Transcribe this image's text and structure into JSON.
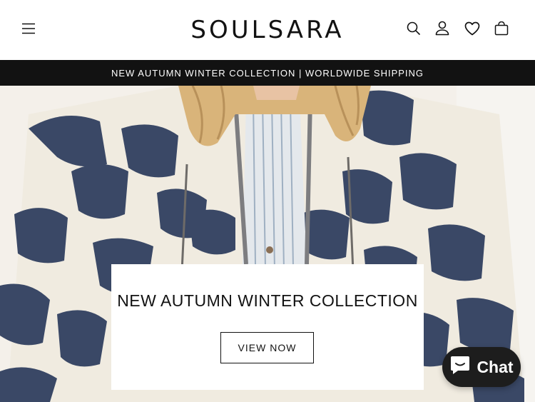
{
  "header": {
    "logo_text": "SOULSARA",
    "icons": {
      "menu": "hamburger-menu-icon",
      "search": "search-icon",
      "account": "user-icon",
      "wishlist": "heart-icon",
      "cart": "shopping-bag-icon"
    }
  },
  "announcement": {
    "text": "NEW AUTUMN WINTER COLLECTION | WORLDWIDE SHIPPING"
  },
  "hero": {
    "title": "NEW AUTUMN WINTER COLLECTION",
    "button_label": "VIEW NOW",
    "image_alt": "Model wearing a navy and cream quilted patchwork jacket over a striped shirt"
  },
  "chat_widget": {
    "label": "Chat",
    "icon": "chat-bubble-icon",
    "background": "#1d1d1d"
  },
  "colors": {
    "announcement_bg": "#121212",
    "quilt_navy": "#3a4866",
    "quilt_cream": "#f1ece2"
  }
}
